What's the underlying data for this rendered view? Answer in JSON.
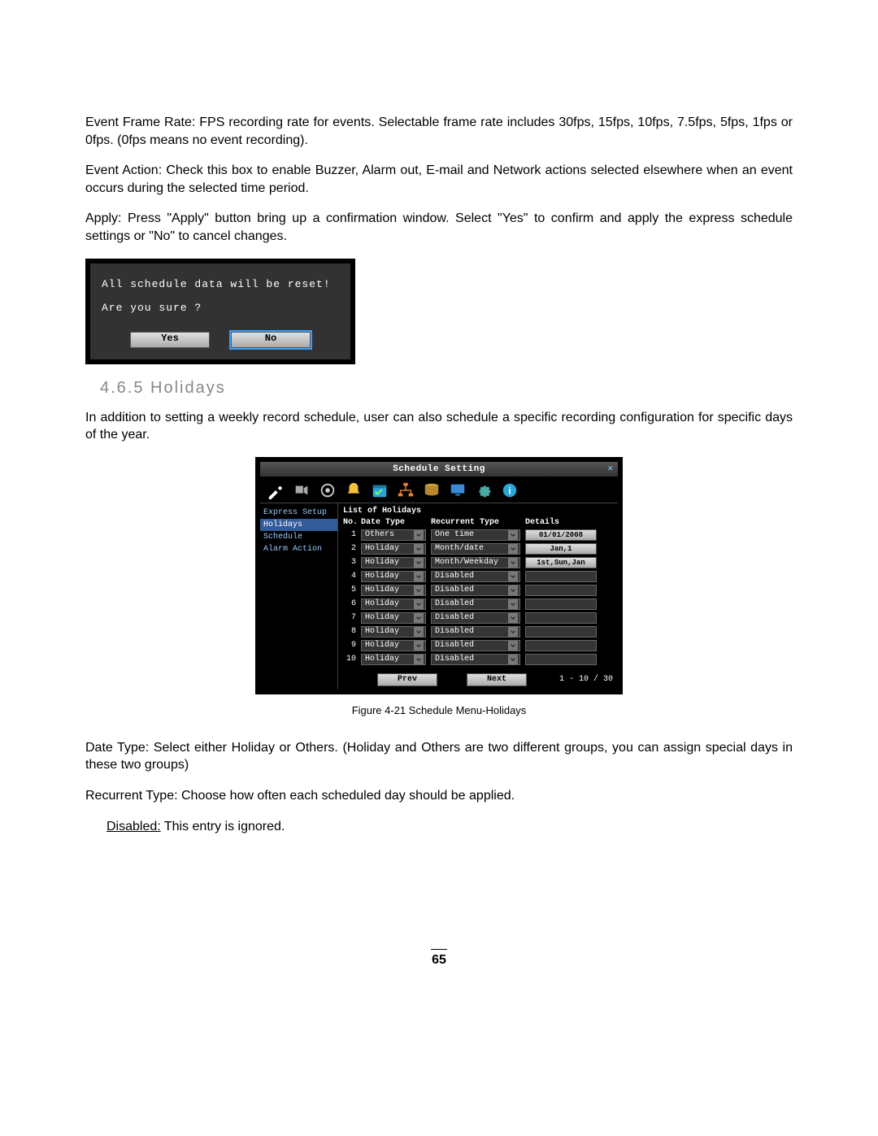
{
  "paragraphs": {
    "p1_label": "Event Frame Rate: ",
    "p1_body": "FPS recording rate for events. Selectable frame rate includes 30fps, 15fps, 10fps, 7.5fps, 5fps, 1fps or 0fps. (0fps means no event recording).",
    "p2_label": "Event Action: ",
    "p2_body": "Check this box to enable Buzzer, Alarm out, E-mail and Network actions selected elsewhere when an event occurs during the selected time period.",
    "p3_label": "Apply: ",
    "p3_body": "Press \"Apply\" button bring up a confirmation window. Select \"Yes\" to confirm and apply the express schedule settings or \"No\" to cancel changes.",
    "p4_body": "In addition to setting a weekly record schedule, user can also schedule a specific recording configuration for specific days of the year.",
    "p5_label": "Date Type: ",
    "p5_body": "Select either Holiday or Others. (Holiday and Others are two different groups, you can assign special days in these two groups)",
    "p6_label": "Recurrent Type: ",
    "p6_body": "Choose how often each scheduled day should be applied.",
    "p7_label": "Disabled:",
    "p7_body": " This entry is ignored."
  },
  "section_title": "4.6.5 Holidays",
  "confirm": {
    "line1": "All schedule data will be reset!",
    "line2": "Are you sure ?",
    "yes": "Yes",
    "no": "No"
  },
  "window": {
    "title": "Schedule Setting",
    "sidebar": [
      "Express Setup",
      "Holidays",
      "Schedule",
      "Alarm Action"
    ],
    "sidebar_active": 1,
    "list_title": "List of Holidays",
    "headers": {
      "no": "No.",
      "date_type": "Date Type",
      "recurrent": "Recurrent Type",
      "details": "Details"
    },
    "rows": [
      {
        "no": "1",
        "date_type": "Others",
        "recurrent": "One time",
        "details": "01/01/2008"
      },
      {
        "no": "2",
        "date_type": "Holiday",
        "recurrent": "Month/date",
        "details": "Jan,1"
      },
      {
        "no": "3",
        "date_type": "Holiday",
        "recurrent": "Month/Weekday",
        "details": "1st,Sun,Jan"
      },
      {
        "no": "4",
        "date_type": "Holiday",
        "recurrent": "Disabled",
        "details": ""
      },
      {
        "no": "5",
        "date_type": "Holiday",
        "recurrent": "Disabled",
        "details": ""
      },
      {
        "no": "6",
        "date_type": "Holiday",
        "recurrent": "Disabled",
        "details": ""
      },
      {
        "no": "7",
        "date_type": "Holiday",
        "recurrent": "Disabled",
        "details": ""
      },
      {
        "no": "8",
        "date_type": "Holiday",
        "recurrent": "Disabled",
        "details": ""
      },
      {
        "no": "9",
        "date_type": "Holiday",
        "recurrent": "Disabled",
        "details": ""
      },
      {
        "no": "10",
        "date_type": "Holiday",
        "recurrent": "Disabled",
        "details": ""
      }
    ],
    "pager": {
      "prev": "Prev",
      "next": "Next",
      "info": "1 - 10 / 30"
    }
  },
  "caption": "Figure 4-21 Schedule Menu-Holidays",
  "page_number": "65"
}
